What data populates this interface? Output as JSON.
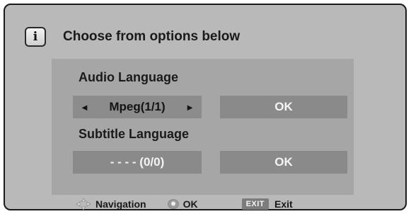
{
  "header": {
    "info_icon_glyph": "i",
    "title": "Choose from options below"
  },
  "audio": {
    "label": "Audio Language",
    "value": "Mpeg(1/1)",
    "left_arrow": "◄",
    "right_arrow": "►",
    "ok_label": "OK"
  },
  "subtitle": {
    "label": "Subtitle Language",
    "value": "- - - - (0/0)",
    "ok_label": "OK"
  },
  "footer": {
    "navigation_label": "Navigation",
    "ok_label": "OK",
    "exit_key": "EXIT",
    "exit_label": "Exit"
  },
  "icons": [
    "info-icon",
    "left-arrow-icon",
    "right-arrow-icon",
    "navigation-icon",
    "ok-key-icon",
    "exit-key-icon"
  ],
  "colors": {
    "panel_bg": "#b9b9b9",
    "content_bg": "#a6a6a6",
    "control_bg": "#8a8a8a",
    "border": "#1a1a1a"
  }
}
